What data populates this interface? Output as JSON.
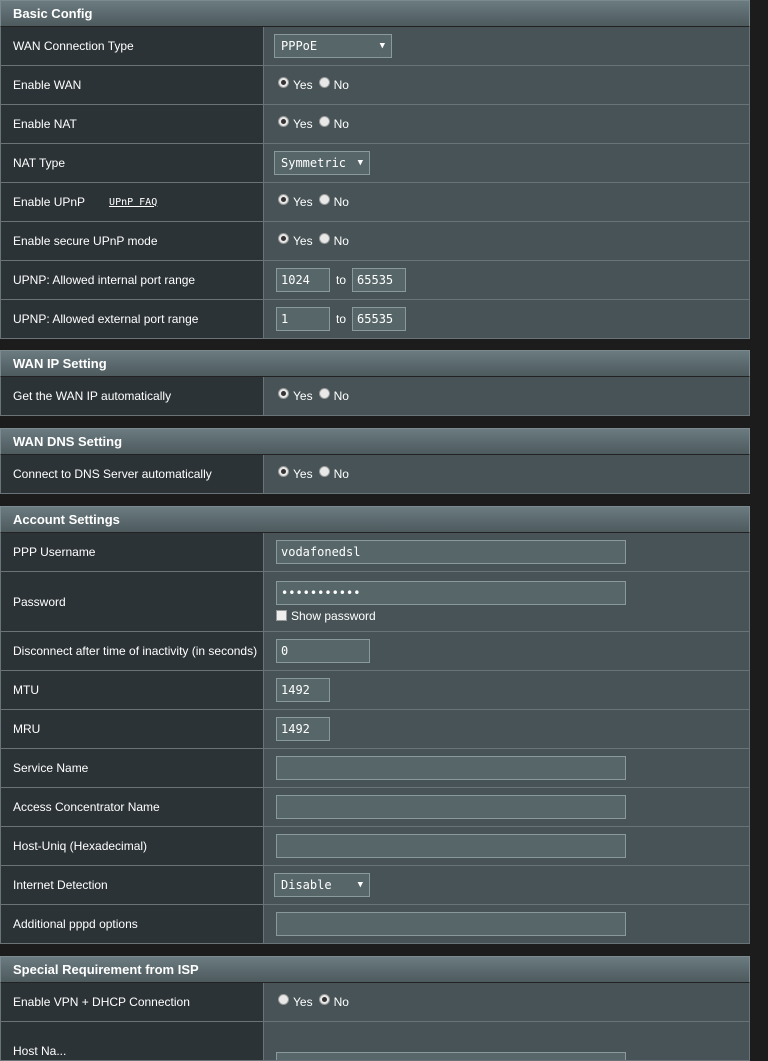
{
  "basic": {
    "title": "Basic Config",
    "wan_type_label": "WAN Connection Type",
    "wan_type_value": "PPPoE",
    "enable_wan_label": "Enable WAN",
    "enable_nat_label": "Enable NAT",
    "nat_type_label": "NAT Type",
    "nat_type_value": "Symmetric",
    "upnp_label": "Enable UPnP",
    "upnp_faq": "UPnP FAQ",
    "secure_upnp_label": "Enable secure UPnP mode",
    "int_range_label": "UPNP: Allowed internal port range",
    "int_from": "1024",
    "int_to": "65535",
    "ext_range_label": "UPNP: Allowed external port range",
    "ext_from": "1",
    "ext_to": "65535"
  },
  "radio": {
    "yes": "Yes",
    "no": "No",
    "to": "to"
  },
  "wanip": {
    "title": "WAN IP Setting",
    "auto_label": "Get the WAN IP automatically"
  },
  "wandns": {
    "title": "WAN DNS Setting",
    "auto_label": "Connect to DNS Server automatically"
  },
  "account": {
    "title": "Account Settings",
    "user_label": "PPP Username",
    "user_value": "vodafonedsl",
    "pass_label": "Password",
    "pass_value": "•••••••••••",
    "show_pw": "Show password",
    "idle_label": "Disconnect after time of inactivity (in seconds)",
    "idle_value": "0",
    "mtu_label": "MTU",
    "mtu_value": "1492",
    "mru_label": "MRU",
    "mru_value": "1492",
    "service_label": "Service Name",
    "service_value": "",
    "ac_label": "Access Concentrator Name",
    "ac_value": "",
    "hostuniq_label": "Host-Uniq (Hexadecimal)",
    "hostuniq_value": "",
    "detect_label": "Internet Detection",
    "detect_value": "Disable",
    "pppd_label": "Additional pppd options",
    "pppd_value": ""
  },
  "isp": {
    "title": "Special Requirement from ISP",
    "vpn_label": "Enable VPN + DHCP Connection",
    "host_label": "Host Na..."
  }
}
